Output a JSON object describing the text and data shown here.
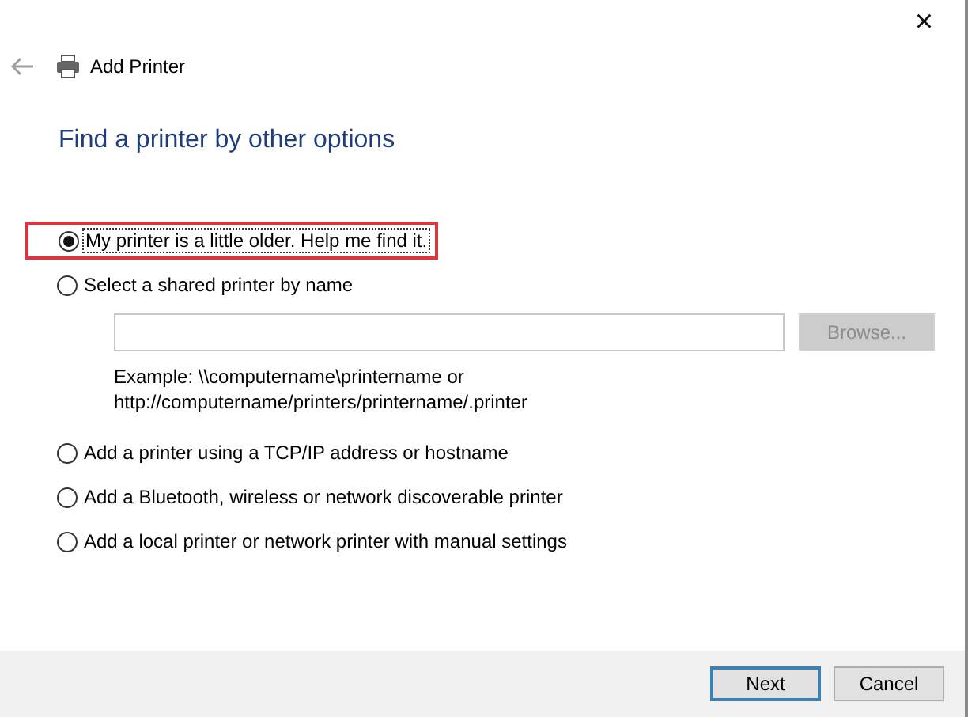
{
  "window": {
    "title": "Add Printer",
    "close": "×"
  },
  "heading": "Find a printer by other options",
  "options": [
    {
      "label": "My printer is a little older. Help me find it.",
      "selected": true,
      "focused": true,
      "highlighted": true
    },
    {
      "label": "Select a shared printer by name",
      "selected": false,
      "focused": false,
      "highlighted": false,
      "field": {
        "button": {
          "label": "Browse...",
          "disabled": true
        },
        "example": [
          "Example: \\\\computername\\printername or",
          "http://computername/printers/printername/.printer"
        ]
      }
    },
    {
      "label": "Add a printer using a TCP/IP address or hostname",
      "selected": false,
      "focused": false,
      "highlighted": false
    },
    {
      "label": "Add a Bluetooth, wireless or network discoverable printer",
      "selected": false,
      "focused": false,
      "highlighted": false
    },
    {
      "label": "Add a local printer or network printer with manual settings",
      "selected": false,
      "focused": false,
      "highlighted": false
    }
  ],
  "buttons": [
    {
      "label": "Next",
      "default": true
    },
    {
      "label": "Cancel",
      "default": false
    }
  ]
}
